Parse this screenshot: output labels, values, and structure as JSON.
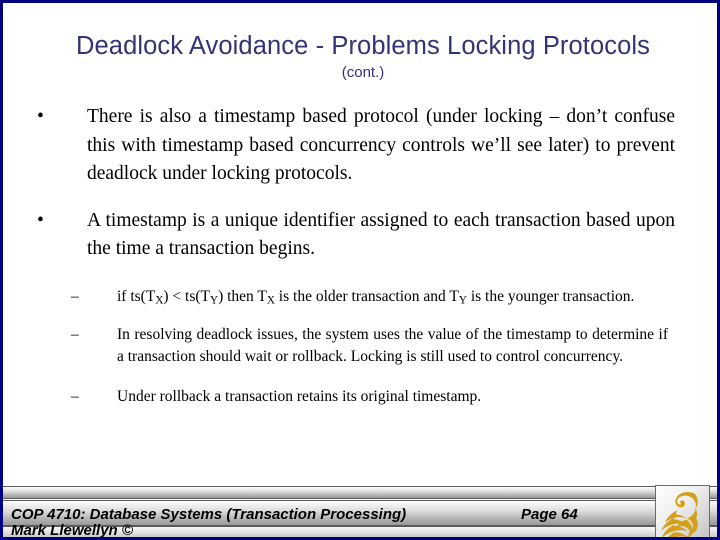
{
  "slide": {
    "title": "Deadlock Avoidance - Problems Locking Protocols",
    "subtitle": "(cont.)",
    "title_color": "#333377",
    "border_color": "#000080",
    "bullet_marker": "•",
    "dash_marker": "–"
  },
  "bullets": [
    {
      "level": 1,
      "text": "There is also a timestamp based protocol (under locking – don’t confuse this with timestamp based concurrency controls we’ll see later) to prevent deadlock under locking protocols."
    },
    {
      "level": 1,
      "text": "A timestamp is a unique identifier assigned to each transaction based upon the time a transaction begins."
    }
  ],
  "subbullets": [
    {
      "level": 2,
      "parts": [
        {
          "t": "if ts(T"
        },
        {
          "sub": "X"
        },
        {
          "t": ") < ts(T"
        },
        {
          "sub": "Y"
        },
        {
          "t": ") then T"
        },
        {
          "sub": "X"
        },
        {
          "t": " is the older transaction and T"
        },
        {
          "sub": "Y"
        },
        {
          "t": " is the younger transaction."
        }
      ],
      "plain": "if ts(TX) < ts(TY) then TX is the older transaction and TY is the younger transaction."
    },
    {
      "level": 2,
      "text": "In resolving deadlock issues, the system uses the value of the timestamp to determine if a transaction should wait or rollback. Locking is still used to control concurrency."
    },
    {
      "level": 2,
      "text": "Under rollback a transaction retains its original timestamp."
    }
  ],
  "footer": {
    "course": "COP 4710: Database Systems  (Transaction Processing)",
    "page": "Page 64",
    "author": "Mark Llewellyn ©",
    "logo_name": "ucf-pegasus-logo",
    "logo_color": "#D4A017"
  }
}
